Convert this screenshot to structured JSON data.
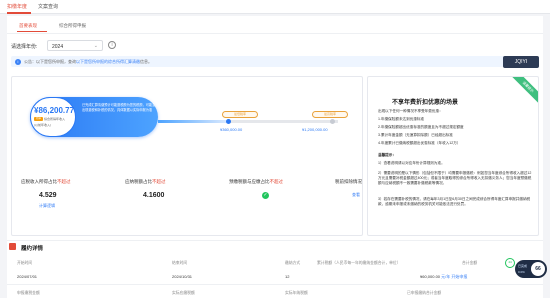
{
  "top_tabs": [
    {
      "label": "扣缴年度"
    },
    {
      "label": "文案查询"
    }
  ],
  "sub_tabs": [
    {
      "label": "首要表现"
    },
    {
      "label": "综合所得申报"
    }
  ],
  "year_label": "请选择年份:",
  "year_value": "2024",
  "info_icon": "i",
  "notice": {
    "text": "公告：以下是您所申报，查询",
    "link": "以下是您所申报的综合所得汇算清缴",
    "tail": "信息。"
  },
  "qr_badge": "JQIYI",
  "pill": {
    "amount": "¥86,200.77",
    "tag": "已申",
    "sub1": "综合所得年收入",
    "sub2": "(以前年收入)",
    "desc": "已完成汇算清缴预计可能退税额为您的税额，可能会出现退税和补税的情况，具体数据以实际申报为准"
  },
  "markers": [
    {
      "label": "最低税率"
    },
    {
      "label": "最高税率"
    }
  ],
  "marker_vals": [
    {
      "value": "¥360,000.00"
    },
    {
      "value": "¥1,200,000.00"
    }
  ],
  "metrics": [
    {
      "label": "应税收入所得占比",
      "red": "不超过",
      "value": "4.529",
      "link": "计算逻辑"
    },
    {
      "label": "应纳税额占比",
      "red": "不超过",
      "value": "4.1600"
    },
    {
      "label": "预缴税额与应缴占比",
      "red": "不超过",
      "value": ""
    },
    {
      "label": "税前扣除情况",
      "red": "",
      "value": "",
      "link": "查看"
    }
  ],
  "rules": {
    "title": "不享年费折扣优惠的场景",
    "ribbon": "温馨提示",
    "lines": [
      "出现以下任何一种情况不享受年费优惠：",
      "1.年缴保险额未达到优惠标准",
      "2.年缴保险额超出优惠标准的额度且为不超过规定额度",
      "3.累计年度金额（无速算扣除额）已经超出标准",
      "4.年度累计已缴纳税额超出优惠标准（年收入12万）",
      "温馨提示：",
      "1）查看说明请以对应年份计算规则为准。",
      "2）需要说明的是以下情形（包括但不限于）均需要申报缴税：例如您当年度综合所得收入超过12万元且需要补税金额超过400元；或者当年度取得的综合所得收入无扣缴义务人；您当年度预缴税额与应纳税额不一致需要补缴税款等情况。",
      "3）若存在需要补税的情况，请在每年3月1日至6月30日之间完成综合所得年度汇算申报并缴纳税款，逾期未申报或未缴纳的税务机关可能依法进行处罚。"
    ]
  },
  "details": {
    "title": "履约详情",
    "headers": [
      "开始时间",
      "结束时间",
      "缴纳方式",
      "累计税额（人民币每一年的缴纳金额合计，单位）",
      "合计金额"
    ],
    "row": [
      "2024/07/01",
      "2024/10/31",
      "12",
      "",
      "¥60,000.00"
    ],
    "row_link": "元/年",
    "row_link2": "开始申报",
    "headers2": [
      "申报缴税金额",
      "实际应缴税额",
      "实际年纳税额",
      "已申报缴纳合计金额"
    ]
  },
  "fab": {
    "pct": "66",
    "l1": "已完成",
    "l2": "0.0%",
    "ring": "44"
  },
  "colors": {
    "accent": "#e24b39",
    "blue": "#2a78f4",
    "green": "#22c55e"
  }
}
